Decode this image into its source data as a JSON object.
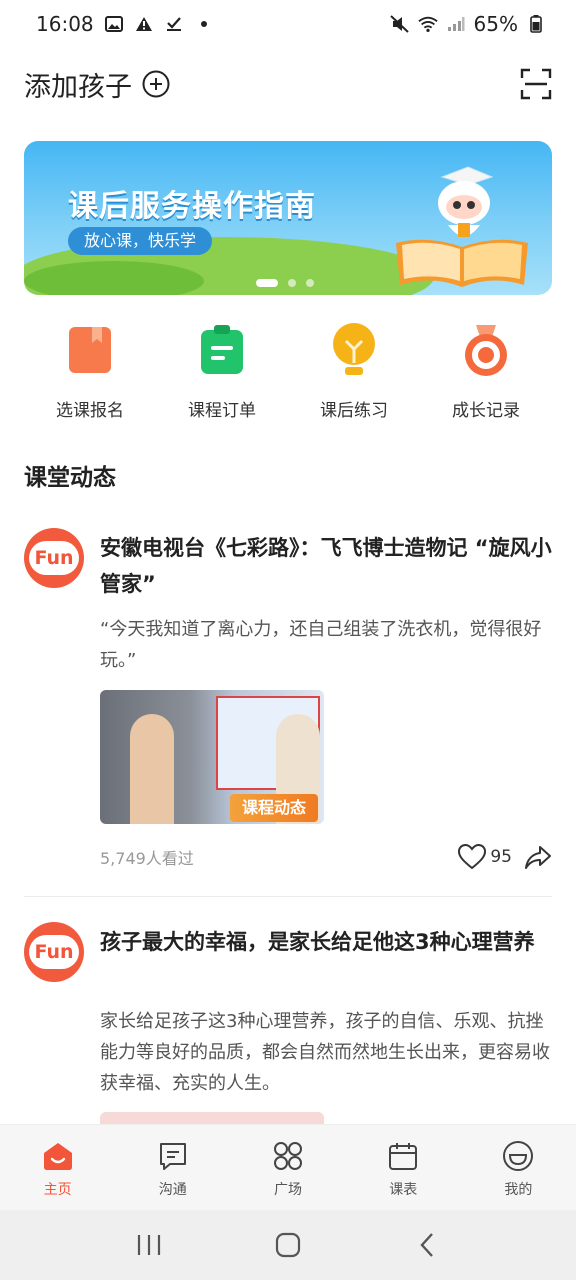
{
  "status_bar": {
    "time": "16:08",
    "battery": "65%"
  },
  "header": {
    "title": "添加孩子"
  },
  "banner": {
    "title": "课后服务操作指南",
    "subtitle": "放心课，快乐学"
  },
  "quick_actions": [
    {
      "label": "选课报名",
      "icon": "bookmark-book-icon",
      "color": "#f77a4c"
    },
    {
      "label": "课程订单",
      "icon": "clipboard-icon",
      "color": "#22c46b"
    },
    {
      "label": "课后练习",
      "icon": "lightbulb-icon",
      "color": "#f6b318"
    },
    {
      "label": "成长记录",
      "icon": "medal-icon",
      "color": "#f56a3c"
    }
  ],
  "section": {
    "title": "课堂动态"
  },
  "feed": [
    {
      "avatar_text": "Fun",
      "title": "安徽电视台《七彩路》：飞飞博士造物记 “旋风小管家”",
      "description": "“今天我知道了离心力，还自己组装了洗衣机，觉得很好玩。”",
      "thumbnail_badge": "课程动态",
      "views": "5,749人看过",
      "likes": "95"
    },
    {
      "avatar_text": "Fun",
      "title": "孩子最大的幸福，是家长给足他这3种心理营养",
      "description": "家长给足孩子这3种心理营养，孩子的自信、乐观、抗挫能力等良好的品质，都会自然而然地生长出来，更容易收获幸福、充实的人生。"
    }
  ],
  "bottom_nav": [
    {
      "label": "主页",
      "icon": "home-icon",
      "active": true
    },
    {
      "label": "沟通",
      "icon": "message-icon",
      "active": false
    },
    {
      "label": "广场",
      "icon": "grid-icon",
      "active": false
    },
    {
      "label": "课表",
      "icon": "calendar-icon",
      "active": false
    },
    {
      "label": "我的",
      "icon": "profile-icon",
      "active": false
    }
  ],
  "colors": {
    "accent": "#f2553a",
    "banner_blue": "#46b6f4"
  }
}
